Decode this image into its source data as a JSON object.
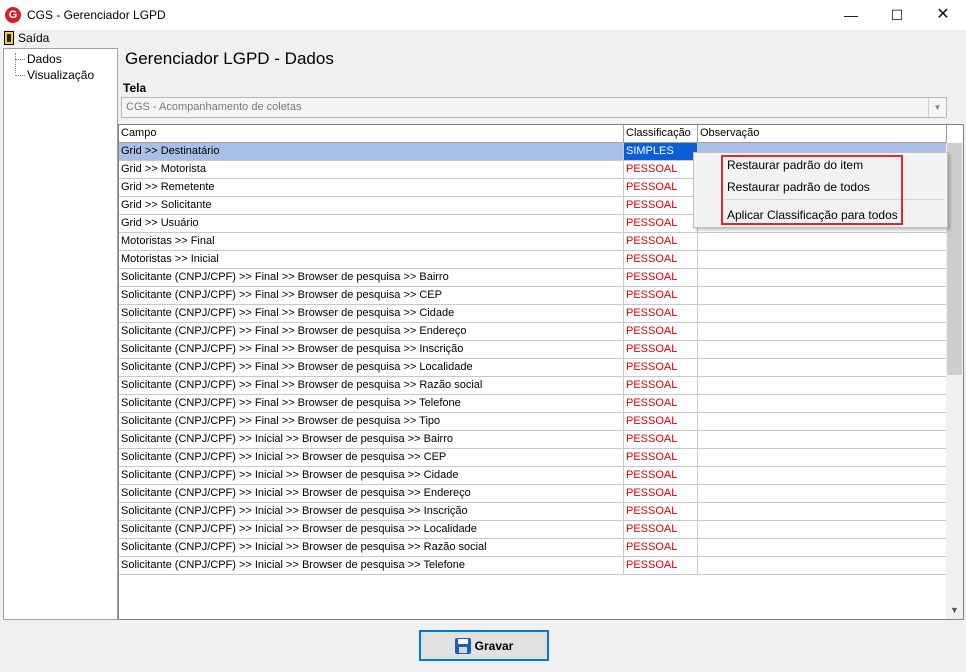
{
  "window": {
    "title": "CGS - Gerenciador LGPD",
    "app_icon_letter": "G",
    "minimize_glyph": "—",
    "maximize_glyph": "☐",
    "close_glyph": "✕"
  },
  "menu": {
    "exit_label": "Saída",
    "exit_icon": "door-exit-icon"
  },
  "tree": {
    "items": [
      {
        "label": "Dados"
      },
      {
        "label": "Visualização"
      }
    ]
  },
  "main": {
    "title": "Gerenciador LGPD - Dados",
    "tela_label": "Tela",
    "tela_value": "CGS - Acompanhamento de coletas"
  },
  "grid": {
    "columns": [
      "Campo",
      "Classificação",
      "Observação"
    ],
    "selected_row": 0,
    "rows": [
      {
        "campo": "Grid >> Destinatário",
        "classificacao": "SIMPLES",
        "observacao": ""
      },
      {
        "campo": "Grid >> Motorista",
        "classificacao": "PESSOAL",
        "observacao": ""
      },
      {
        "campo": "Grid >> Remetente",
        "classificacao": "PESSOAL",
        "observacao": ""
      },
      {
        "campo": "Grid >> Solicitante",
        "classificacao": "PESSOAL",
        "observacao": ""
      },
      {
        "campo": "Grid >> Usuário",
        "classificacao": "PESSOAL",
        "observacao": ""
      },
      {
        "campo": "Motoristas >> Final",
        "classificacao": "PESSOAL",
        "observacao": ""
      },
      {
        "campo": "Motoristas >> Inicial",
        "classificacao": "PESSOAL",
        "observacao": ""
      },
      {
        "campo": "Solicitante (CNPJ/CPF) >> Final >> Browser de pesquisa >> Bairro",
        "classificacao": "PESSOAL",
        "observacao": ""
      },
      {
        "campo": "Solicitante (CNPJ/CPF) >> Final >> Browser de pesquisa >> CEP",
        "classificacao": "PESSOAL",
        "observacao": ""
      },
      {
        "campo": "Solicitante (CNPJ/CPF) >> Final >> Browser de pesquisa >> Cidade",
        "classificacao": "PESSOAL",
        "observacao": ""
      },
      {
        "campo": "Solicitante (CNPJ/CPF) >> Final >> Browser de pesquisa >> Endereço",
        "classificacao": "PESSOAL",
        "observacao": ""
      },
      {
        "campo": "Solicitante (CNPJ/CPF) >> Final >> Browser de pesquisa >> Inscrição",
        "classificacao": "PESSOAL",
        "observacao": ""
      },
      {
        "campo": "Solicitante (CNPJ/CPF) >> Final >> Browser de pesquisa >> Localidade",
        "classificacao": "PESSOAL",
        "observacao": ""
      },
      {
        "campo": "Solicitante (CNPJ/CPF) >> Final >> Browser de pesquisa >> Razão social",
        "classificacao": "PESSOAL",
        "observacao": ""
      },
      {
        "campo": "Solicitante (CNPJ/CPF) >> Final >> Browser de pesquisa >> Telefone",
        "classificacao": "PESSOAL",
        "observacao": ""
      },
      {
        "campo": "Solicitante (CNPJ/CPF) >> Final >> Browser de pesquisa >> Tipo",
        "classificacao": "PESSOAL",
        "observacao": ""
      },
      {
        "campo": "Solicitante (CNPJ/CPF) >> Inicial >> Browser de pesquisa >> Bairro",
        "classificacao": "PESSOAL",
        "observacao": ""
      },
      {
        "campo": "Solicitante (CNPJ/CPF) >> Inicial >> Browser de pesquisa >> CEP",
        "classificacao": "PESSOAL",
        "observacao": ""
      },
      {
        "campo": "Solicitante (CNPJ/CPF) >> Inicial >> Browser de pesquisa >> Cidade",
        "classificacao": "PESSOAL",
        "observacao": ""
      },
      {
        "campo": "Solicitante (CNPJ/CPF) >> Inicial >> Browser de pesquisa >> Endereço",
        "classificacao": "PESSOAL",
        "observacao": ""
      },
      {
        "campo": "Solicitante (CNPJ/CPF) >> Inicial >> Browser de pesquisa >> Inscrição",
        "classificacao": "PESSOAL",
        "observacao": ""
      },
      {
        "campo": "Solicitante (CNPJ/CPF) >> Inicial >> Browser de pesquisa >> Localidade",
        "classificacao": "PESSOAL",
        "observacao": ""
      },
      {
        "campo": "Solicitante (CNPJ/CPF) >> Inicial >> Browser de pesquisa >> Razão social",
        "classificacao": "PESSOAL",
        "observacao": ""
      },
      {
        "campo": "Solicitante (CNPJ/CPF) >> Inicial >> Browser de pesquisa >> Telefone",
        "classificacao": "PESSOAL",
        "observacao": ""
      }
    ]
  },
  "context_menu": {
    "items": [
      {
        "label": "Restaurar padrão do item"
      },
      {
        "label": "Restaurar padrão de todos"
      },
      {
        "label": "Aplicar Classificação para todos"
      }
    ]
  },
  "footer": {
    "save_label": "Gravar",
    "save_icon": "floppy-disk-icon"
  },
  "colors": {
    "pessoal": "#e00000",
    "selected_row": "#a8c0e8",
    "selected_cell": "#0a5fd6",
    "highlight_box": "#e0282e"
  }
}
